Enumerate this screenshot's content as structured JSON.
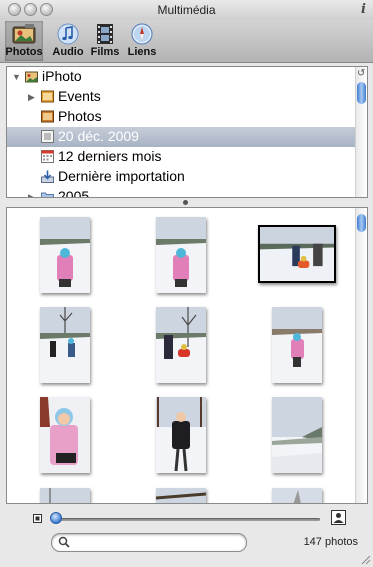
{
  "window": {
    "title": "Multimédia"
  },
  "toolbar": {
    "tabs": [
      {
        "label": "Photos",
        "icon": "iphoto-icon",
        "selected": true
      },
      {
        "label": "Audio",
        "icon": "music-note-icon",
        "selected": false
      },
      {
        "label": "Films",
        "icon": "film-icon",
        "selected": false
      },
      {
        "label": "Liens",
        "icon": "compass-icon",
        "selected": false
      }
    ]
  },
  "sources": {
    "items": [
      {
        "label": "iPhoto",
        "icon": "iphoto-icon",
        "expanded": true,
        "selected": false
      },
      {
        "label": "Events",
        "icon": "events-icon",
        "expanded": false,
        "selected": false
      },
      {
        "label": "Photos",
        "icon": "photos-icon",
        "selected": false
      },
      {
        "label": "20 déc. 2009",
        "icon": "event-icon",
        "selected": true
      },
      {
        "label": "12 derniers mois",
        "icon": "calendar-icon",
        "selected": false
      },
      {
        "label": "Dernière importation",
        "icon": "import-icon",
        "selected": false
      },
      {
        "label": "2005",
        "icon": "folder-icon",
        "expanded": false,
        "selected": false
      }
    ]
  },
  "photos": {
    "count_label": "147 photos"
  },
  "search": {
    "placeholder": "",
    "value": ""
  },
  "zoom": {
    "level": 0.0
  },
  "colors": {
    "selection": "#b1bbcc",
    "scroll_thumb": "#5a8fdc",
    "snow": "#f2f4f8",
    "sky": "#cdd5e0"
  }
}
